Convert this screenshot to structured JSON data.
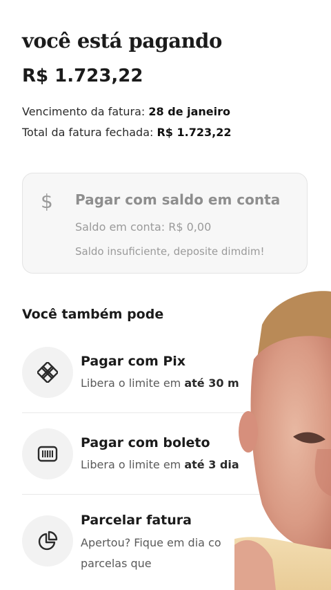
{
  "header": {
    "title": "você está pagando",
    "amount": "R$ 1.723,22"
  },
  "invoice": {
    "due_label": "Vencimento da fatura:",
    "due_value": "28 de janeiro",
    "total_label": "Total da fatura fechada:",
    "total_value": "R$ 1.723,22"
  },
  "balance_option": {
    "icon": "dollar-icon",
    "title": "Pagar com saldo em conta",
    "balance_text": "Saldo em conta: R$ 0,00",
    "warning": "Saldo insuficiente, deposite dimdim!"
  },
  "other_options": {
    "title": "Você também pode",
    "items": [
      {
        "icon": "pix-icon",
        "title": "Pagar com Pix",
        "subtitle_prefix": "Libera o limite em ",
        "subtitle_bold": "até 30 m"
      },
      {
        "icon": "barcode-icon",
        "title": "Pagar com boleto",
        "subtitle_prefix": "Libera o limite em ",
        "subtitle_bold": "até 3 dia"
      },
      {
        "icon": "pie-chart-icon",
        "title": "Parcelar fatura",
        "subtitle_line1": "Apertou? Fique em dia co",
        "subtitle_line2": "parcelas que"
      }
    ]
  },
  "colors": {
    "text_primary": "#1b1b1b",
    "text_muted": "#9a9a9a",
    "card_bg": "#f7f7f7",
    "icon_circle_bg": "#f2f2f2"
  }
}
